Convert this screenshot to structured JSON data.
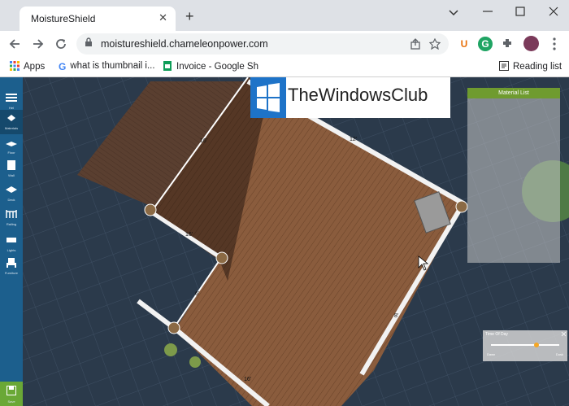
{
  "browser": {
    "tab_title": "MoistureShield",
    "tab_close": "✕",
    "new_tab": "+",
    "url": "moistureshield.chameleonpower.com",
    "bookmarks": [
      {
        "label": "Apps",
        "icon": "apps-grid-icon"
      },
      {
        "label": "what is thumbnail i...",
        "icon": "google-icon"
      },
      {
        "label": "Invoice - Google Sh",
        "icon": "sheets-icon"
      }
    ],
    "reading_list": "Reading list",
    "extensions": [
      "U",
      "G"
    ]
  },
  "watermark": {
    "text": "TheWindowsClub"
  },
  "app": {
    "sidebar": [
      {
        "label": "Hel",
        "icon": "menu-icon"
      },
      {
        "label": "Materials",
        "icon": "materials-icon"
      },
      {
        "label": "Floor",
        "icon": "floor-icon"
      },
      {
        "label": "Wall",
        "icon": "wall-icon"
      },
      {
        "label": "Deck",
        "icon": "deck-icon"
      },
      {
        "label": "Railing",
        "icon": "railing-icon"
      },
      {
        "label": "Lights",
        "icon": "lights-icon"
      },
      {
        "label": "Furniture",
        "icon": "furniture-icon"
      }
    ],
    "save_label": "Save",
    "material_list_title": "Material List",
    "time_of_day": {
      "title": "Time Of Day",
      "left": "Dawn",
      "right": "Dusk",
      "value": 0.67
    },
    "deck_labels": [
      "16'",
      "12'",
      "16'",
      "6'",
      "8'",
      "16'",
      "12'"
    ]
  },
  "colors": {
    "sidebar": "#1c5f8d",
    "save": "#6aa836",
    "material_header": "#6f9b2f",
    "deck": "#7a5238"
  }
}
